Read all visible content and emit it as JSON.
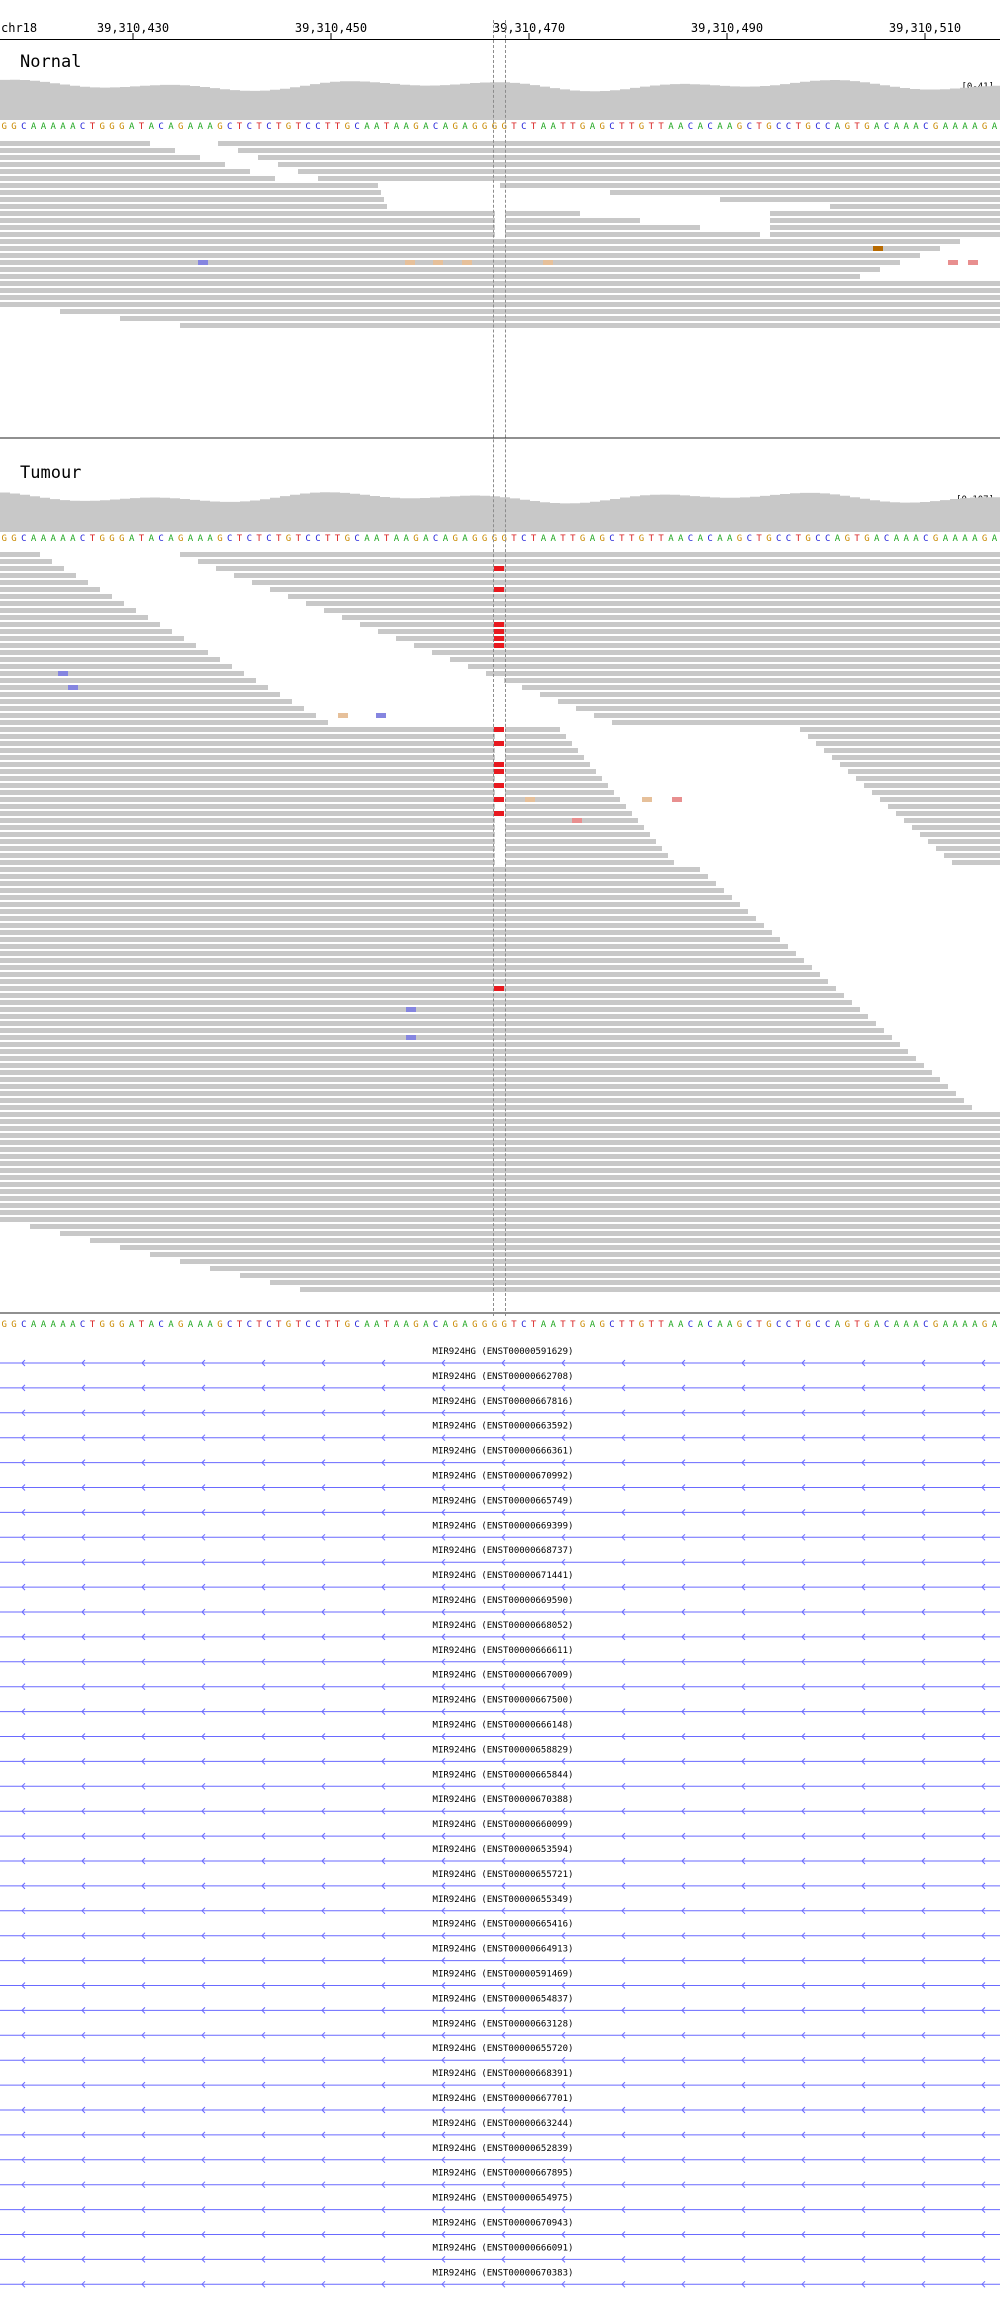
{
  "ruler": {
    "chrom": "chr18",
    "ticks": [
      "39,310,430",
      "39,310,450",
      "39,310,470",
      "39,310,490",
      "39,310,510"
    ]
  },
  "reference_sequence": "GGCAAAAACTGGGATACAGAAAGCTCTCTGTCCTTGCAATAAGACAGAGGGGTCTAATTGAGCTTGTTAACACAAGCTGCCTGCCAGTGACAAACGAAAAGA",
  "colors": {
    "read": "#c8c8c8",
    "coverage": "#c8c8c8",
    "mismatch_red": "#e8191f",
    "mismatch_blue": "#8585e0",
    "transcript_line": "#6a6aff",
    "base_A": "#22a822",
    "base_C": "#1f1fd8",
    "base_G": "#c98a00",
    "base_T": "#d81f1f"
  },
  "tracks": [
    {
      "name": "Nornal",
      "range_label": "[0-41]"
    },
    {
      "name": "Tumour",
      "range_label": "[0-107]"
    }
  ],
  "genes": [
    "MIR924HG (ENST00000591629)",
    "MIR924HG (ENST00000662708)",
    "MIR924HG (ENST00000667816)",
    "MIR924HG (ENST00000663592)",
    "MIR924HG (ENST00000666361)",
    "MIR924HG (ENST00000670992)",
    "MIR924HG (ENST00000665749)",
    "MIR924HG (ENST00000669399)",
    "MIR924HG (ENST00000668737)",
    "MIR924HG (ENST00000671441)",
    "MIR924HG (ENST00000669590)",
    "MIR924HG (ENST00000668052)",
    "MIR924HG (ENST00000666611)",
    "MIR924HG (ENST00000667009)",
    "MIR924HG (ENST00000667500)",
    "MIR924HG (ENST00000666148)",
    "MIR924HG (ENST00000658829)",
    "MIR924HG (ENST00000665844)",
    "MIR924HG (ENST00000670388)",
    "MIR924HG (ENST00000660099)",
    "MIR924HG (ENST00000653594)",
    "MIR924HG (ENST00000655721)",
    "MIR924HG (ENST00000655349)",
    "MIR924HG (ENST00000665416)",
    "MIR924HG (ENST00000664913)",
    "MIR924HG (ENST00000591469)",
    "MIR924HG (ENST00000654837)",
    "MIR924HG (ENST00000663128)",
    "MIR924HG (ENST00000655720)",
    "MIR924HG (ENST00000668391)",
    "MIR924HG (ENST00000667701)",
    "MIR924HG (ENST00000663244)",
    "MIR924HG (ENST00000652839)",
    "MIR924HG (ENST00000667895)",
    "MIR924HG (ENST00000654975)",
    "MIR924HG (ENST00000670943)",
    "MIR924HG (ENST00000666091)",
    "MIR924HG (ENST00000670383)"
  ]
}
